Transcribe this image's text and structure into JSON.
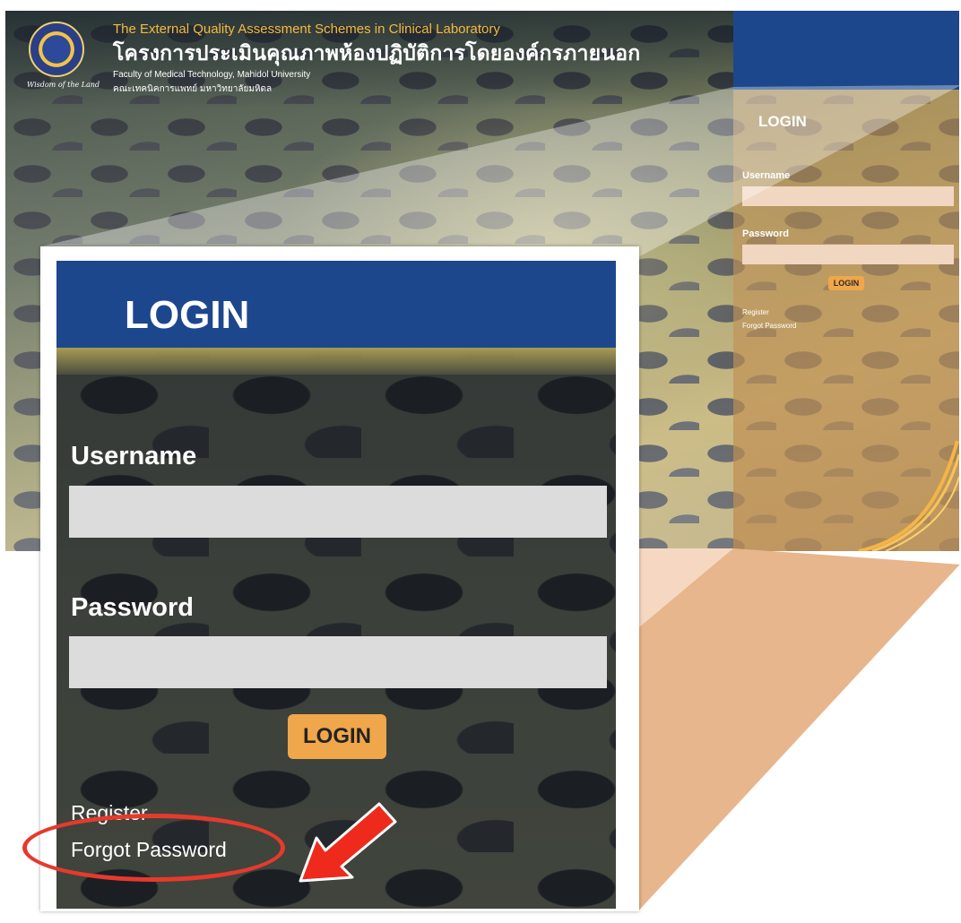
{
  "site": {
    "title_en": "The External Quality Assessment Schemes in Clinical Laboratory",
    "title_th": "โครงการประเมินคุณภาพห้องปฏิบัติการโดยองค์กรภายนอก",
    "faculty_en": "Faculty of Medical Technology, Mahidol University",
    "faculty_th": "คณะเทคนิคการแพทย์ มหาวิทยาลัยมหิดล",
    "logo_caption": "Wisdom of the Land"
  },
  "mini_login": {
    "title": "LOGIN",
    "username_label": "Username",
    "password_label": "Password",
    "button_label": "LOGIN",
    "register_link": "Register",
    "forgot_link": "Forgot Password"
  },
  "zoom_login": {
    "title": "LOGIN",
    "username_label": "Username",
    "username_value": "",
    "password_label": "Password",
    "password_value": "",
    "button_label": "LOGIN",
    "register_link": "Register",
    "forgot_link": "Forgot Password"
  },
  "annotation": {
    "highlight_color": "#e63a2c",
    "arrow_color": "#ee2a1d",
    "target": "Forgot Password"
  },
  "colors": {
    "header_blue": "#1d478d",
    "button_orange": "#f0a64a",
    "title_gold": "#f4b93e"
  }
}
